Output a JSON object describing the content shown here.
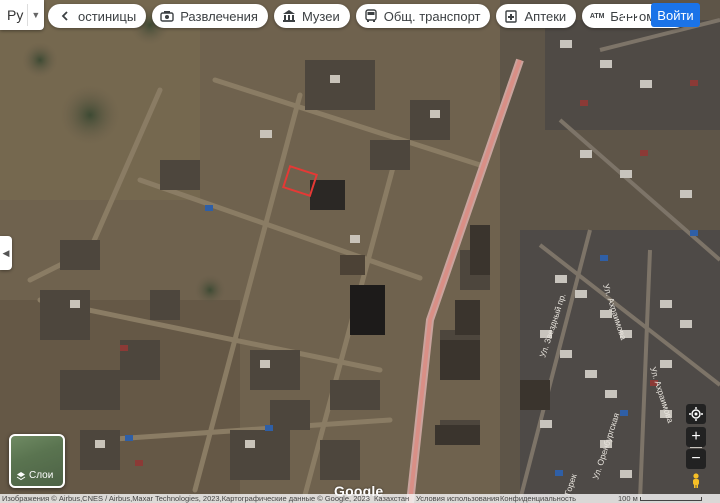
{
  "header": {
    "lang": "Ру",
    "signin": "Войти",
    "chips": [
      {
        "label": "остиницы",
        "icon": "chevron-left-icon"
      },
      {
        "label": "Развлечения",
        "icon": "camera-icon"
      },
      {
        "label": "Музеи",
        "icon": "museum-icon"
      },
      {
        "label": "Общ. транспорт",
        "icon": "bus-icon"
      },
      {
        "label": "Аптеки",
        "icon": "pharmacy-icon"
      },
      {
        "label": "Банкоматы",
        "icon": "atm-icon"
      }
    ],
    "atm_icon_text": "ATM"
  },
  "layers": {
    "label": "Слои"
  },
  "footer": {
    "attribution": "Изображения © Airbus,CNES / Airbus,Maxar Technologies, 2023,Картографические данные © Google, 2023",
    "country": "Казахстан",
    "terms": "Условия использования",
    "privacy": "Конфиденциальность",
    "scale": "100 м"
  },
  "logo": "Google",
  "streets": [
    "Ул. Ахраимова",
    "Ул. Звездный пр.",
    "Ул. Ахраимова",
    "Ул. Оренбургская",
    "Горек"
  ],
  "colors": {
    "accent": "#1a73e8",
    "road": "#d98f86",
    "marker": "#e53935"
  }
}
